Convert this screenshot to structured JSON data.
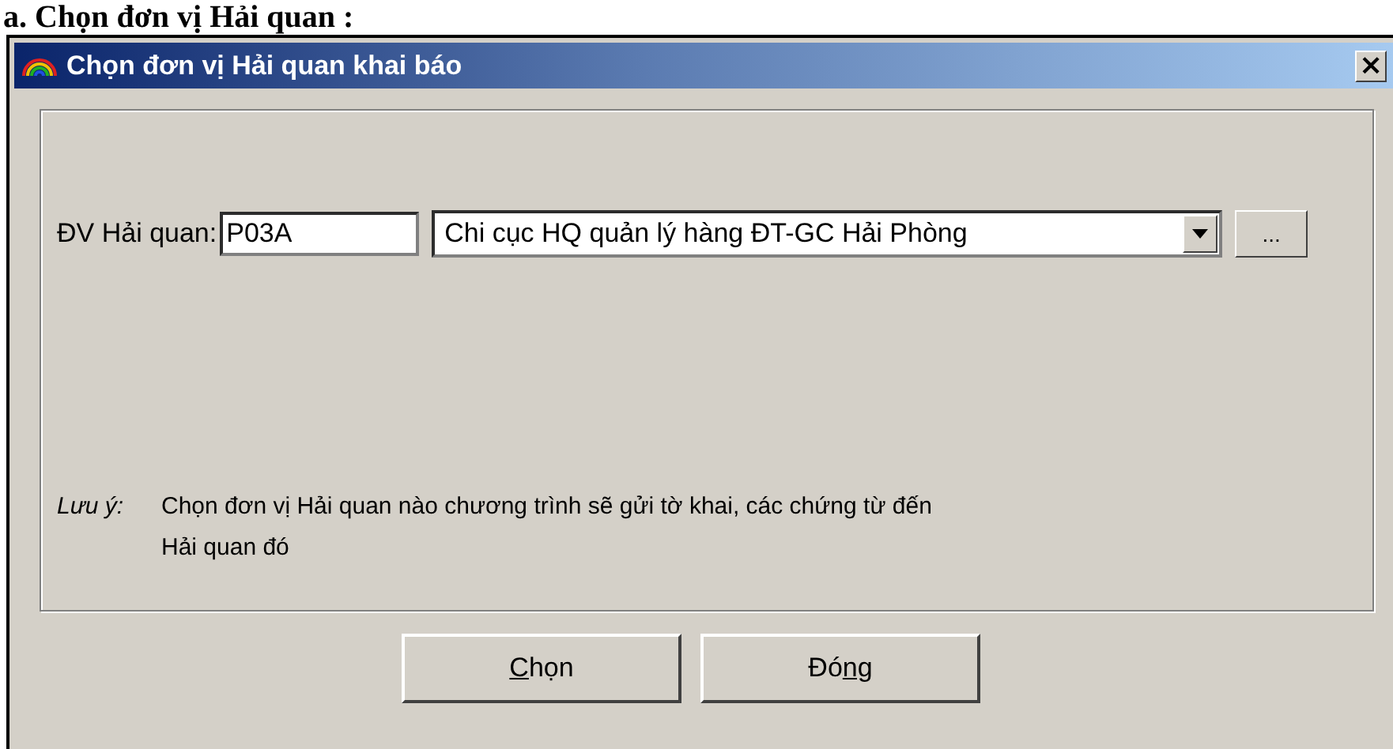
{
  "heading": "a. Chọn đơn vị Hải quan :",
  "window": {
    "title": "Chọn đơn vị Hải quan khai báo",
    "close": "×"
  },
  "customs_unit": {
    "label": "ĐV Hải quan:",
    "value": "P03A",
    "dropdown_value": "Chi cục HQ quản lý hàng ĐT-GC Hải Phòng",
    "browse": "..."
  },
  "note": {
    "label": "Lưu ý:",
    "text": "Chọn đơn vị Hải quan nào chương trình sẽ gửi tờ khai, các chứng từ đến Hải quan đó"
  },
  "buttons": [
    {
      "label": [
        {
          "text": "C",
          "underlined": true
        },
        {
          "text": "họn",
          "underlined": false
        }
      ]
    },
    {
      "label": [
        {
          "text": "Đó",
          "underlined": false
        },
        {
          "text": "ng",
          "underlined": true
        }
      ]
    }
  ]
}
